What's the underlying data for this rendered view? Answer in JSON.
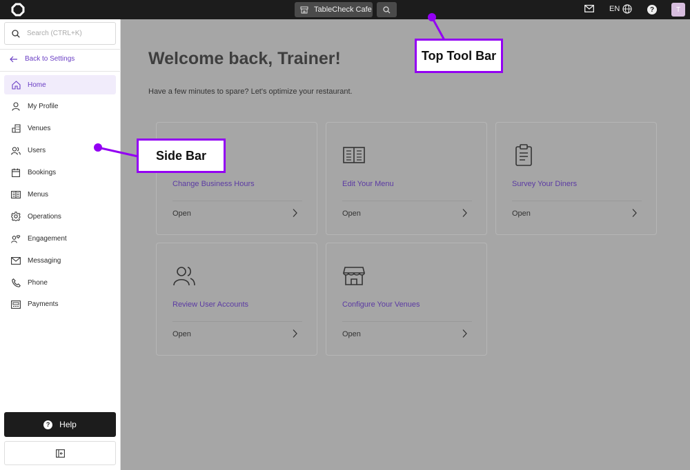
{
  "topbar": {
    "venue_label": "TableCheck Cafe",
    "lang_label": "EN",
    "avatar_initial": "T"
  },
  "sidebar": {
    "search_placeholder": "Search (CTRL+K)",
    "back_label": "Back to Settings",
    "items": [
      {
        "label": "Home",
        "icon": "home-icon"
      },
      {
        "label": "My Profile",
        "icon": "person-icon"
      },
      {
        "label": "Venues",
        "icon": "building-icon"
      },
      {
        "label": "Users",
        "icon": "users-icon"
      },
      {
        "label": "Bookings",
        "icon": "calendar-icon"
      },
      {
        "label": "Menus",
        "icon": "menu-book-icon"
      },
      {
        "label": "Operations",
        "icon": "gear-icon"
      },
      {
        "label": "Engagement",
        "icon": "heart-person-icon"
      },
      {
        "label": "Messaging",
        "icon": "mail-icon"
      },
      {
        "label": "Phone",
        "icon": "phone-icon"
      },
      {
        "label": "Payments",
        "icon": "payment-icon"
      }
    ],
    "help_label": "Help"
  },
  "main": {
    "welcome": "Welcome back, Trainer!",
    "subtitle": "Have a few minutes to spare? Let's optimize your restaurant.",
    "cards": [
      {
        "title": "Change Business Hours",
        "open": "Open",
        "icon": "clock-icon"
      },
      {
        "title": "Edit Your Menu",
        "open": "Open",
        "icon": "menu-book-icon"
      },
      {
        "title": "Survey Your Diners",
        "open": "Open",
        "icon": "clipboard-icon"
      },
      {
        "title": "Review User Accounts",
        "open": "Open",
        "icon": "users-icon"
      },
      {
        "title": "Configure Your Venues",
        "open": "Open",
        "icon": "storefront-icon"
      }
    ]
  },
  "annotations": {
    "top_tool_bar": "Top Tool Bar",
    "side_bar": "Side Bar",
    "color": "#9300f3"
  }
}
